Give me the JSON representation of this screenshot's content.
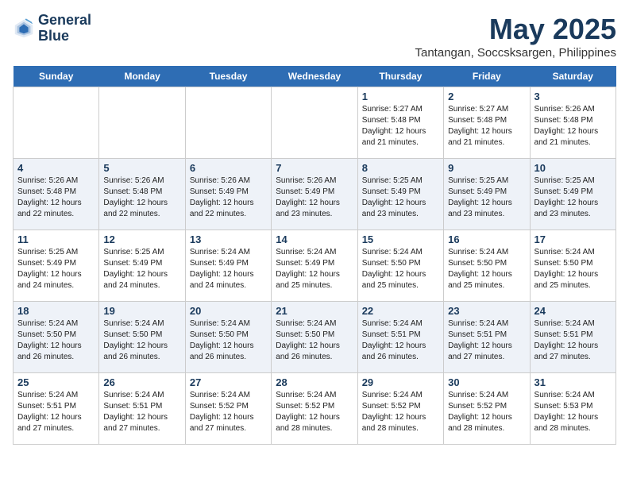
{
  "logo": {
    "line1": "General",
    "line2": "Blue"
  },
  "title": "May 2025",
  "location": "Tantangan, Soccsksargen, Philippines",
  "headers": [
    "Sunday",
    "Monday",
    "Tuesday",
    "Wednesday",
    "Thursday",
    "Friday",
    "Saturday"
  ],
  "weeks": [
    [
      {
        "day": "",
        "info": ""
      },
      {
        "day": "",
        "info": ""
      },
      {
        "day": "",
        "info": ""
      },
      {
        "day": "",
        "info": ""
      },
      {
        "day": "1",
        "info": "Sunrise: 5:27 AM\nSunset: 5:48 PM\nDaylight: 12 hours\nand 21 minutes."
      },
      {
        "day": "2",
        "info": "Sunrise: 5:27 AM\nSunset: 5:48 PM\nDaylight: 12 hours\nand 21 minutes."
      },
      {
        "day": "3",
        "info": "Sunrise: 5:26 AM\nSunset: 5:48 PM\nDaylight: 12 hours\nand 21 minutes."
      }
    ],
    [
      {
        "day": "4",
        "info": "Sunrise: 5:26 AM\nSunset: 5:48 PM\nDaylight: 12 hours\nand 22 minutes."
      },
      {
        "day": "5",
        "info": "Sunrise: 5:26 AM\nSunset: 5:48 PM\nDaylight: 12 hours\nand 22 minutes."
      },
      {
        "day": "6",
        "info": "Sunrise: 5:26 AM\nSunset: 5:49 PM\nDaylight: 12 hours\nand 22 minutes."
      },
      {
        "day": "7",
        "info": "Sunrise: 5:26 AM\nSunset: 5:49 PM\nDaylight: 12 hours\nand 23 minutes."
      },
      {
        "day": "8",
        "info": "Sunrise: 5:25 AM\nSunset: 5:49 PM\nDaylight: 12 hours\nand 23 minutes."
      },
      {
        "day": "9",
        "info": "Sunrise: 5:25 AM\nSunset: 5:49 PM\nDaylight: 12 hours\nand 23 minutes."
      },
      {
        "day": "10",
        "info": "Sunrise: 5:25 AM\nSunset: 5:49 PM\nDaylight: 12 hours\nand 23 minutes."
      }
    ],
    [
      {
        "day": "11",
        "info": "Sunrise: 5:25 AM\nSunset: 5:49 PM\nDaylight: 12 hours\nand 24 minutes."
      },
      {
        "day": "12",
        "info": "Sunrise: 5:25 AM\nSunset: 5:49 PM\nDaylight: 12 hours\nand 24 minutes."
      },
      {
        "day": "13",
        "info": "Sunrise: 5:24 AM\nSunset: 5:49 PM\nDaylight: 12 hours\nand 24 minutes."
      },
      {
        "day": "14",
        "info": "Sunrise: 5:24 AM\nSunset: 5:49 PM\nDaylight: 12 hours\nand 25 minutes."
      },
      {
        "day": "15",
        "info": "Sunrise: 5:24 AM\nSunset: 5:50 PM\nDaylight: 12 hours\nand 25 minutes."
      },
      {
        "day": "16",
        "info": "Sunrise: 5:24 AM\nSunset: 5:50 PM\nDaylight: 12 hours\nand 25 minutes."
      },
      {
        "day": "17",
        "info": "Sunrise: 5:24 AM\nSunset: 5:50 PM\nDaylight: 12 hours\nand 25 minutes."
      }
    ],
    [
      {
        "day": "18",
        "info": "Sunrise: 5:24 AM\nSunset: 5:50 PM\nDaylight: 12 hours\nand 26 minutes."
      },
      {
        "day": "19",
        "info": "Sunrise: 5:24 AM\nSunset: 5:50 PM\nDaylight: 12 hours\nand 26 minutes."
      },
      {
        "day": "20",
        "info": "Sunrise: 5:24 AM\nSunset: 5:50 PM\nDaylight: 12 hours\nand 26 minutes."
      },
      {
        "day": "21",
        "info": "Sunrise: 5:24 AM\nSunset: 5:50 PM\nDaylight: 12 hours\nand 26 minutes."
      },
      {
        "day": "22",
        "info": "Sunrise: 5:24 AM\nSunset: 5:51 PM\nDaylight: 12 hours\nand 26 minutes."
      },
      {
        "day": "23",
        "info": "Sunrise: 5:24 AM\nSunset: 5:51 PM\nDaylight: 12 hours\nand 27 minutes."
      },
      {
        "day": "24",
        "info": "Sunrise: 5:24 AM\nSunset: 5:51 PM\nDaylight: 12 hours\nand 27 minutes."
      }
    ],
    [
      {
        "day": "25",
        "info": "Sunrise: 5:24 AM\nSunset: 5:51 PM\nDaylight: 12 hours\nand 27 minutes."
      },
      {
        "day": "26",
        "info": "Sunrise: 5:24 AM\nSunset: 5:51 PM\nDaylight: 12 hours\nand 27 minutes."
      },
      {
        "day": "27",
        "info": "Sunrise: 5:24 AM\nSunset: 5:52 PM\nDaylight: 12 hours\nand 27 minutes."
      },
      {
        "day": "28",
        "info": "Sunrise: 5:24 AM\nSunset: 5:52 PM\nDaylight: 12 hours\nand 28 minutes."
      },
      {
        "day": "29",
        "info": "Sunrise: 5:24 AM\nSunset: 5:52 PM\nDaylight: 12 hours\nand 28 minutes."
      },
      {
        "day": "30",
        "info": "Sunrise: 5:24 AM\nSunset: 5:52 PM\nDaylight: 12 hours\nand 28 minutes."
      },
      {
        "day": "31",
        "info": "Sunrise: 5:24 AM\nSunset: 5:53 PM\nDaylight: 12 hours\nand 28 minutes."
      }
    ]
  ]
}
